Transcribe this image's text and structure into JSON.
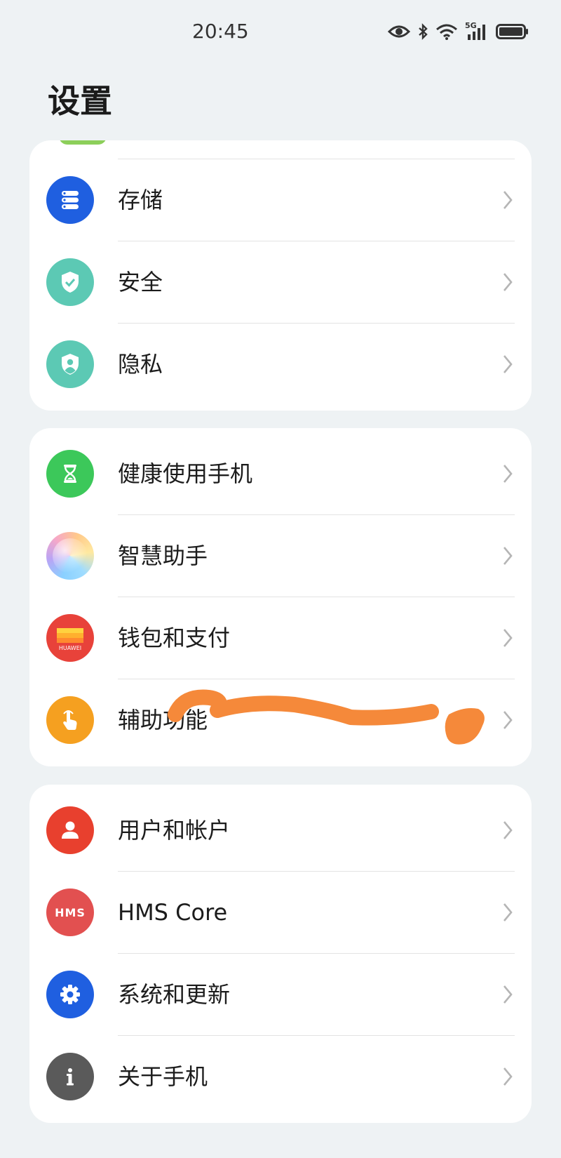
{
  "status_bar": {
    "time": "20:45",
    "network_type": "5G"
  },
  "page_title": "设置",
  "groups": [
    {
      "items": [
        {
          "label": "存储",
          "icon": "storage-icon",
          "color": "#1f5fe0"
        },
        {
          "label": "安全",
          "icon": "shield-check-icon",
          "color": "#5cc9b4"
        },
        {
          "label": "隐私",
          "icon": "privacy-shield-icon",
          "color": "#5cc9b4"
        }
      ]
    },
    {
      "items": [
        {
          "label": "健康使用手机",
          "icon": "hourglass-icon",
          "color": "#3cc85a"
        },
        {
          "label": "智慧助手",
          "icon": "smart-assistant-icon",
          "color": "#c6a4f0"
        },
        {
          "label": "钱包和支付",
          "icon": "wallet-icon",
          "color": "#e8423a",
          "icon_text": "HUAWEI"
        },
        {
          "label": "辅助功能",
          "icon": "accessibility-hand-icon",
          "color": "#f5a020"
        }
      ]
    },
    {
      "items": [
        {
          "label": "用户和帐户",
          "icon": "user-icon",
          "color": "#e8402e"
        },
        {
          "label": "HMS Core",
          "icon": "hms-core-icon",
          "color": "#e25050",
          "icon_text": "HMS"
        },
        {
          "label": "系统和更新",
          "icon": "gear-icon",
          "color": "#1f5fe0"
        },
        {
          "label": "关于手机",
          "icon": "info-icon",
          "color": "#5a5a5a"
        }
      ]
    }
  ],
  "overlay": {
    "scribble_color": "#f5893a"
  }
}
